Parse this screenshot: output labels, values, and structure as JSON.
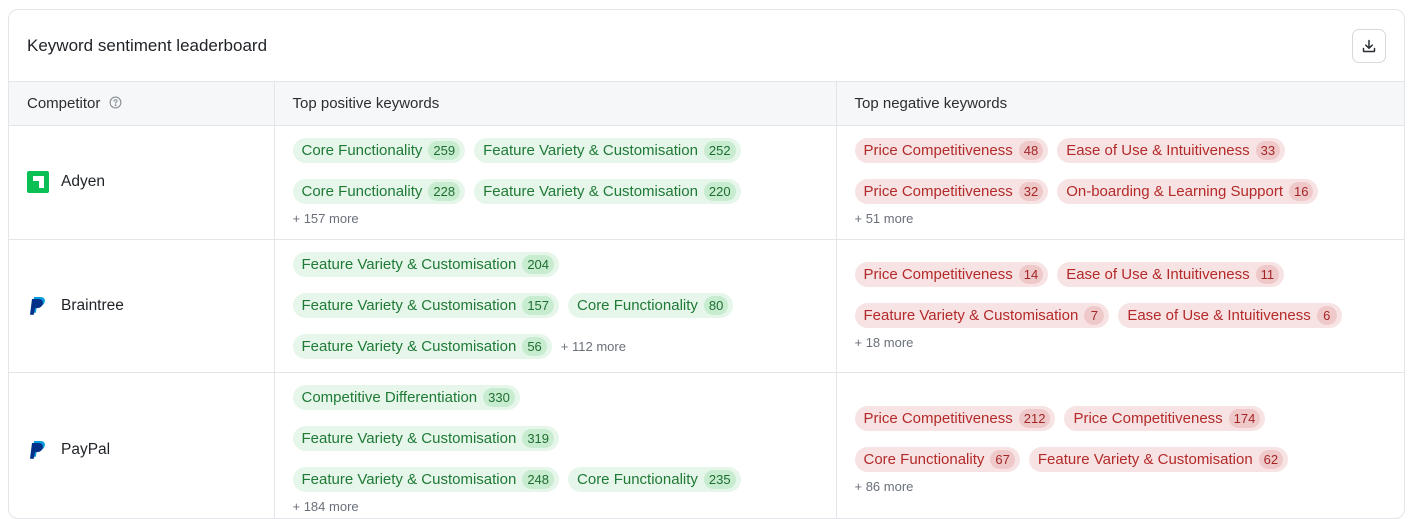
{
  "card": {
    "title": "Keyword sentiment leaderboard",
    "download_icon": "download-icon"
  },
  "table": {
    "headers": {
      "competitor": "Competitor",
      "positive": "Top positive keywords",
      "negative": "Top negative keywords"
    },
    "rows": [
      {
        "competitor": "Adyen",
        "logo_color": "#0abf53",
        "positive": [
          {
            "label": "Core Functionality",
            "count": "259"
          },
          {
            "label": "Feature Variety & Customisation",
            "count": "252"
          },
          {
            "label": "Core Functionality",
            "count": "228"
          },
          {
            "label": "Feature Variety & Customisation",
            "count": "220"
          }
        ],
        "positive_more": "+ 157 more",
        "negative": [
          {
            "label": "Price Competitiveness",
            "count": "48"
          },
          {
            "label": "Ease of Use & Intuitiveness",
            "count": "33"
          },
          {
            "label": "Price Competitiveness",
            "count": "32"
          },
          {
            "label": "On-boarding & Learning Support",
            "count": "16"
          }
        ],
        "negative_more": "+ 51 more"
      },
      {
        "competitor": "Braintree",
        "logo_color": "#003087",
        "positive": [
          {
            "label": "Feature Variety & Customisation",
            "count": "204"
          },
          {
            "label": "Feature Variety & Customisation",
            "count": "157"
          },
          {
            "label": "Core Functionality",
            "count": "80"
          },
          {
            "label": "Feature Variety & Customisation",
            "count": "56"
          }
        ],
        "positive_more": "+ 112 more",
        "negative": [
          {
            "label": "Price Competitiveness",
            "count": "14"
          },
          {
            "label": "Ease of Use & Intuitiveness",
            "count": "11"
          },
          {
            "label": "Feature Variety & Customisation",
            "count": "7"
          },
          {
            "label": "Ease of Use & Intuitiveness",
            "count": "6"
          }
        ],
        "negative_more": "+ 18 more"
      },
      {
        "competitor": "PayPal",
        "logo_color": "#003087",
        "positive": [
          {
            "label": "Competitive Differentiation",
            "count": "330"
          },
          {
            "label": "Feature Variety & Customisation",
            "count": "319"
          },
          {
            "label": "Feature Variety & Customisation",
            "count": "248"
          },
          {
            "label": "Core Functionality",
            "count": "235"
          }
        ],
        "positive_more": "+ 184 more",
        "negative": [
          {
            "label": "Price Competitiveness",
            "count": "212"
          },
          {
            "label": "Price Competitiveness",
            "count": "174"
          },
          {
            "label": "Core Functionality",
            "count": "67"
          },
          {
            "label": "Feature Variety & Customisation",
            "count": "62"
          }
        ],
        "negative_more": "+ 86 more"
      }
    ]
  },
  "colors": {
    "positive_bg": "#e6f6ea",
    "positive_text": "#1f7a36",
    "negative_bg": "#f7e3e3",
    "negative_text": "#b42a2a"
  }
}
